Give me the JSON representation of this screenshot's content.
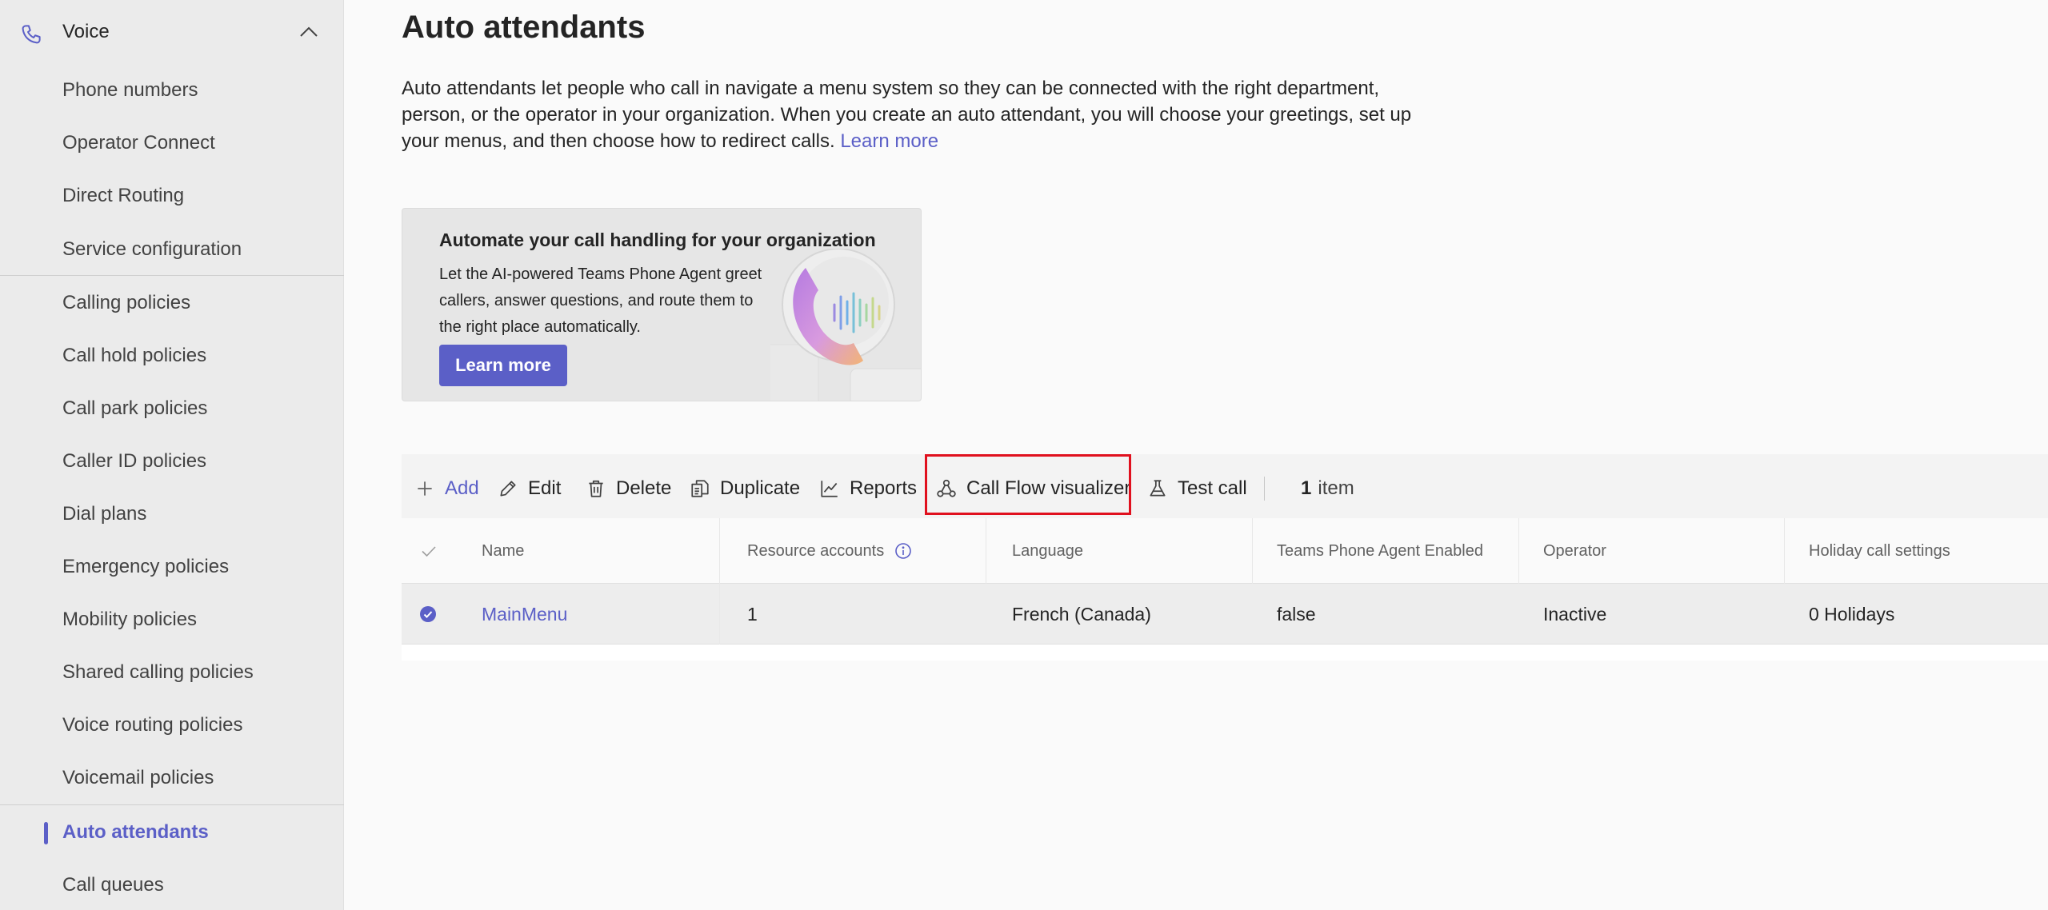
{
  "sidebar": {
    "group": {
      "label": "Voice"
    },
    "items": [
      {
        "label": "Phone numbers"
      },
      {
        "label": "Operator Connect"
      },
      {
        "label": "Direct Routing"
      },
      {
        "label": "Service configuration"
      },
      {
        "label": "Calling policies"
      },
      {
        "label": "Call hold policies"
      },
      {
        "label": "Call park policies"
      },
      {
        "label": "Caller ID policies"
      },
      {
        "label": "Dial plans"
      },
      {
        "label": "Emergency policies"
      },
      {
        "label": "Mobility policies"
      },
      {
        "label": "Shared calling policies"
      },
      {
        "label": "Voice routing policies"
      },
      {
        "label": "Voicemail policies"
      },
      {
        "label": "Auto attendants"
      },
      {
        "label": "Call queues"
      }
    ]
  },
  "page": {
    "title": "Auto attendants",
    "description": "Auto attendants let people who call in navigate a menu system so they can be connected with the right department, person, or the operator in your organization. When you create an auto attendant, you will choose your greetings, set up your menus, and then choose how to redirect calls.",
    "learn_more": "Learn more"
  },
  "promo": {
    "title": "Automate your call handling for your organization",
    "body": "Let the AI-powered Teams Phone Agent greet callers, answer questions, and route them to the right place automatically.",
    "button": "Learn more"
  },
  "toolbar": {
    "add": "Add",
    "edit": "Edit",
    "delete": "Delete",
    "duplicate": "Duplicate",
    "reports": "Reports",
    "call_flow_visualizer": "Call Flow visualizer",
    "test_call": "Test call",
    "item_count_number": "1",
    "item_count_label": "item"
  },
  "table": {
    "columns": [
      "Name",
      "Resource accounts",
      "Language",
      "Teams Phone Agent Enabled",
      "Operator",
      "Holiday call settings"
    ],
    "rows": [
      {
        "name": "MainMenu",
        "resource_accounts": "1",
        "language": "French (Canada)",
        "agent_enabled": "false",
        "operator": "Inactive",
        "holiday": "0 Holidays",
        "selected": true
      }
    ]
  },
  "colors": {
    "accent": "#5b5fc7",
    "highlight": "#e0101e"
  }
}
